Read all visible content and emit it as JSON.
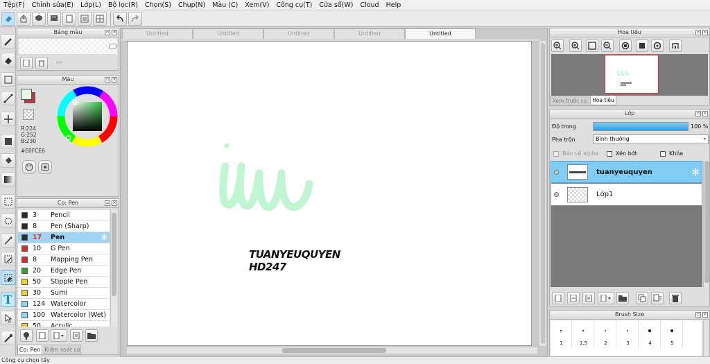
{
  "menu": [
    "Tệp(F)",
    "Chỉnh sửa(E)",
    "Lớp(L)",
    "Bộ lọc(R)",
    "Chọn(S)",
    "Chụp(N)",
    "Màu (C)",
    "Xem(V)",
    "Công cụ(T)",
    "Cửa sổ(W)",
    "Cloud",
    "Help"
  ],
  "palette_panel": {
    "title": "Bảng màu",
    "dash": "---"
  },
  "color_panel": {
    "title": "Màu",
    "r": "R:224",
    "g": "G:252",
    "b": "B:230",
    "hex": "#E0FCE6",
    "main_color": "#e0fce6"
  },
  "brush_panel": {
    "title": "Cọ: Pen",
    "brushes": [
      {
        "size": "3",
        "name": "Pencil",
        "color": "#2a2a2a"
      },
      {
        "size": "8",
        "name": "Pen (Sharp)",
        "color": "#2a2a2a"
      },
      {
        "size": "17",
        "name": "Pen",
        "color": "#2a2a2a"
      },
      {
        "size": "10",
        "name": "G Pen",
        "color": "#e02828"
      },
      {
        "size": "8",
        "name": "Mapping Pen",
        "color": "#e02828"
      },
      {
        "size": "20",
        "name": "Edge Pen",
        "color": "#28a828"
      },
      {
        "size": "50",
        "name": "Stipple Pen",
        "color": "#f0d028"
      },
      {
        "size": "30",
        "name": "Sumi",
        "color": "#f0d028"
      },
      {
        "size": "124",
        "name": "Watercolor",
        "color": "#88d8f0"
      },
      {
        "size": "100",
        "name": "Watercolor (Wet)",
        "color": "#88d8f0"
      },
      {
        "size": "50",
        "name": "Acrylic",
        "color": "#f0d028"
      }
    ],
    "tab_brush": "Cọ: Pen",
    "tab_control": "Kiểm soát cọ"
  },
  "tabs": [
    "Untitled",
    "Untitled",
    "Untitled",
    "Untitled",
    "Untitled"
  ],
  "canvas": {
    "text_line1": "TUANYEUQUYEN",
    "text_line2": "HD247"
  },
  "navigator": {
    "title": "Hoa tiêu",
    "tab_preview": "Xem trước cọ",
    "tab_nav": "Hoa tiêu"
  },
  "layer_panel": {
    "title": "Lớp",
    "opacity_label": "Độ trong",
    "opacity_value": "100 %",
    "opacity": 1.0,
    "blend_label": "Pha trộn",
    "blend_value": "Bình thường",
    "protect_alpha": "Bảo vệ alpha",
    "clipping": "Xén bớt",
    "lock": "Khóa",
    "layers": [
      {
        "name": "tuanyeuquyen"
      },
      {
        "name": "Lớp1"
      }
    ]
  },
  "brushsize_panel": {
    "title": "Brush Size",
    "sizes": [
      "1",
      "1.5",
      "2",
      "3",
      "4",
      "5"
    ]
  },
  "status": "Công cụ chọn tẩy"
}
